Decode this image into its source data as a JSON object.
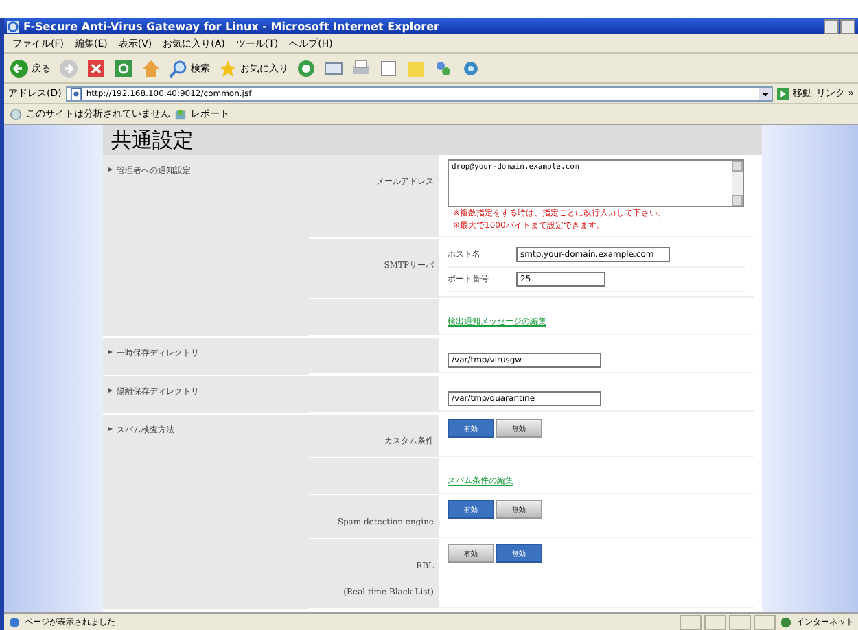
{
  "window": {
    "title": "F-Secure Anti-Virus Gateway for Linux - Microsoft Internet Explorer"
  },
  "menu": [
    "ファイル(F)",
    "編集(E)",
    "表示(V)",
    "お気に入り(A)",
    "ツール(T)",
    "ヘルプ(H)"
  ],
  "toolbar": {
    "back": "戻る",
    "search": "検索",
    "favorites": "お気に入り"
  },
  "address": {
    "label": "アドレス(D)",
    "url": "http://192.168.100.40:9012/common.jsf",
    "go": "移動",
    "links": "リンク »"
  },
  "links_bar": {
    "status": "このサイトは分析されていません",
    "report": "レポート"
  },
  "page": {
    "heading": "共通設定",
    "sections": [
      {
        "name": "管理者への通知設定",
        "items": [
          {
            "kind": "textarea",
            "label": "メールアドレス",
            "value": "drop@your-domain.example.com",
            "notes": [
              "※複数指定をする時は、指定ごとに改行入力して下さい。",
              "※最大で1000バイトまで設定できます。"
            ]
          },
          {
            "kind": "fields",
            "label": "SMTPサーバ",
            "fields": [
              {
                "label": "ホスト名",
                "value": "smtp.your-domain.example.com"
              },
              {
                "label": "ポート番号",
                "value": "25"
              }
            ]
          },
          {
            "kind": "link",
            "text": "検出通知メッセージの編集"
          }
        ]
      },
      {
        "name": "一時保存ディレクトリ",
        "items": [
          {
            "kind": "input",
            "value": "/var/tmp/virusgw"
          }
        ]
      },
      {
        "name": "隔離保存ディレクトリ",
        "items": [
          {
            "kind": "input",
            "value": "/var/tmp/quarantine"
          }
        ]
      },
      {
        "name": "スパム検査方法",
        "items": [
          {
            "kind": "toggle",
            "label": "カスタム条件",
            "options": [
              {
                "label": "有効",
                "selected": true
              },
              {
                "label": "無効",
                "selected": false
              }
            ]
          },
          {
            "kind": "link",
            "text": "スパム条件の編集"
          },
          {
            "kind": "toggle",
            "label": "Spam detection engine",
            "options": [
              {
                "label": "有効",
                "selected": true
              },
              {
                "label": "無効",
                "selected": false
              }
            ]
          },
          {
            "kind": "toggle",
            "label": "RBL\n(Real time Black List)",
            "options": [
              {
                "label": "有効",
                "selected": false
              },
              {
                "label": "無効",
                "selected": true
              }
            ]
          }
        ]
      }
    ]
  },
  "status_bar": {
    "text": "ページが表示されました",
    "zone": "インターネット"
  }
}
